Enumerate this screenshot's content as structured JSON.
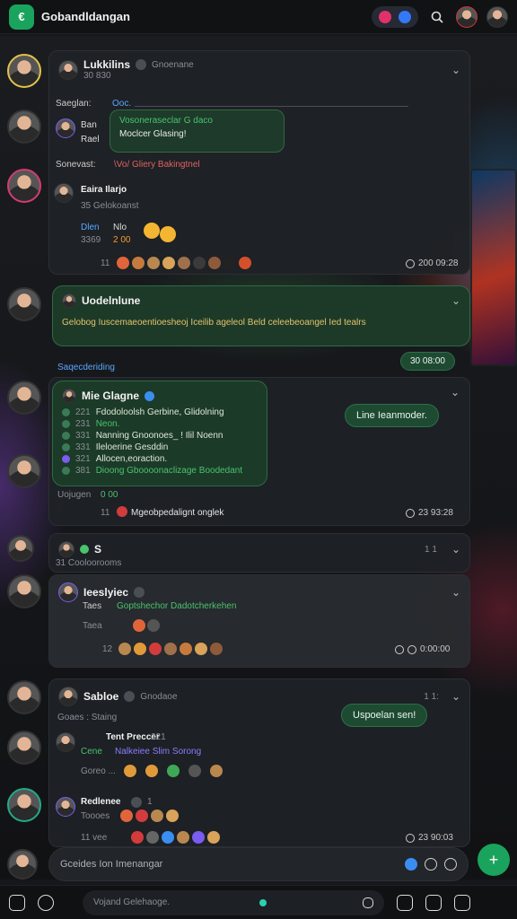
{
  "app": {
    "logo_text": "€",
    "title": "Gobandldangan"
  },
  "threads": [
    {
      "name": "Lukkilins",
      "handle": "Gnoenane",
      "submeta": "30 830",
      "label_sender": "Saeglan:",
      "label_top": "Ooc.",
      "bubble_line1": "Vosoneraseclar G daco",
      "bubble_line2": "Moclcer Glasing!",
      "bubble_name1": "Ban",
      "bubble_name2": "Rael",
      "forward_label": "Sonevast:",
      "forward_text": "\\Vo/ Gliery Bakingtnel",
      "sub_name": "Eaira Ilarjo",
      "sub_meta": "35 Gelokoanst",
      "sub_row1_label": "Dlen",
      "sub_row1_val": "Nlo",
      "sub_row2_label": "3369",
      "sub_row2_val": "2 00",
      "reactions_count": "11",
      "time": "200 09:28"
    },
    {
      "name": "Uodelnlune",
      "message": "Gelobog Iuscemaeoentioesheoj Iceilib ageleol Beld celeebeoangel Ied tealrs",
      "time": "30 08:00",
      "section_label": "Saqecderiding"
    },
    {
      "name": "Mie Glagne",
      "items": [
        {
          "num": "221",
          "text": "Fdodoloolsh Gerbine, Glidolning"
        },
        {
          "num": "231",
          "text": "Neon."
        },
        {
          "num": "331",
          "text": "Nanning Gnoonoes_ ! Ilil Noenn"
        },
        {
          "num": "331",
          "text": "Ileloerine Gesddin"
        },
        {
          "num": "321",
          "text": "Allocen,eoraction."
        },
        {
          "num": "381",
          "text": "Dioong Gboooonaclizage Boodedant"
        }
      ],
      "footer_label": "Uojugen",
      "footer_val": "0 00",
      "footer_count": "11",
      "footer_text": "Mgeobpedalignt onglek",
      "time": "23 93:28",
      "bubble_out": "Line Ieanmoder."
    },
    {
      "name": "S",
      "sub": "31 Cooloorooms",
      "count": "1 1"
    },
    {
      "name": "Ieeslyiec",
      "line_label": "Taes",
      "line_text": "Goptshechor Dadotcherkehen",
      "sub_label": "Taea",
      "reactions_count": "12",
      "time": "0:00:00"
    },
    {
      "name": "Sabloe",
      "handle": "Gnodaoe",
      "sub": "Goaes : Staing",
      "count": "1 1:",
      "bubble_out": "Uspoelan sen!",
      "reply_name": "Tent Preccer",
      "reply_num": "221",
      "reply_label": "Cene",
      "reply_text": "Nalkeiee Slim Sorong",
      "reply_sub": "Goreo ..."
    },
    {
      "name": "Redlenee",
      "count": "1",
      "sub": "Toooes",
      "reactions_count": "11 vee",
      "time": "23 90:03"
    }
  ],
  "composer": {
    "placeholder": "Gceides Ion Imenangar",
    "send": "+"
  },
  "bottom": {
    "search_placeholder": "Vojand Gelehaoge."
  }
}
